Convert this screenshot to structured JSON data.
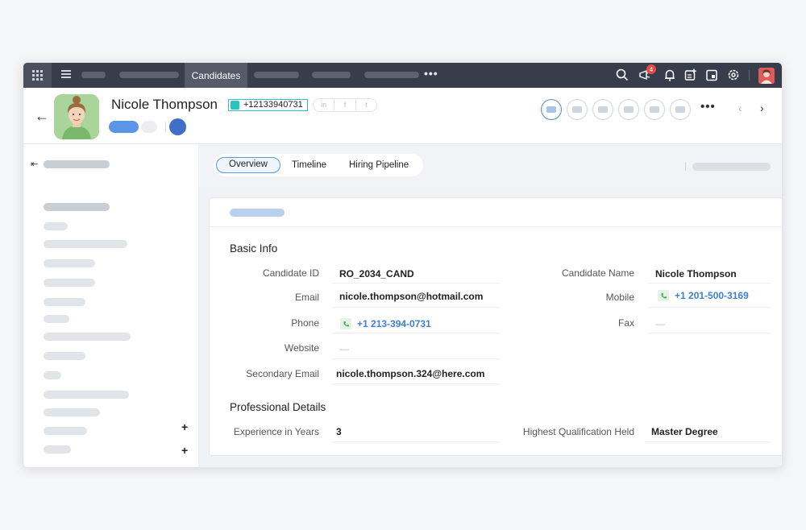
{
  "topbar": {
    "active_tab": "Candidates",
    "notification_count": "4"
  },
  "header": {
    "name": "Nicole Thompson",
    "phone_tag": "+12133940731",
    "socials": [
      "in",
      "f",
      "t"
    ]
  },
  "tabs": [
    "Overview",
    "Timeline",
    "Hiring Pipeline"
  ],
  "sections": {
    "basic": "Basic Info",
    "professional": "Professional Details"
  },
  "basic_left": [
    {
      "label": "Candidate ID",
      "value": "RO_2034_CAND"
    },
    {
      "label": "Email",
      "value": "nicole.thompson@hotmail.com"
    },
    {
      "label": "Phone",
      "value": "+1 213-394-0731"
    },
    {
      "label": "Website",
      "value": "—"
    },
    {
      "label": "Secondary Email",
      "value": "nicole.thompson.324@here.com"
    }
  ],
  "basic_right": [
    {
      "label": "Candidate Name",
      "value": "Nicole Thompson"
    },
    {
      "label": "Mobile",
      "value": "+1 201-500-3169"
    },
    {
      "label": "Fax",
      "value": "—"
    }
  ],
  "professional": [
    {
      "label": "Experience in Years",
      "value": "3"
    },
    {
      "label": "Highest Qualification Held",
      "value": "Master Degree"
    }
  ],
  "colors": {
    "topbar": "#373d4b",
    "link": "#3f7fd0",
    "accent": "#5b96e6",
    "phone_tag_border": "#2cc3bd"
  }
}
